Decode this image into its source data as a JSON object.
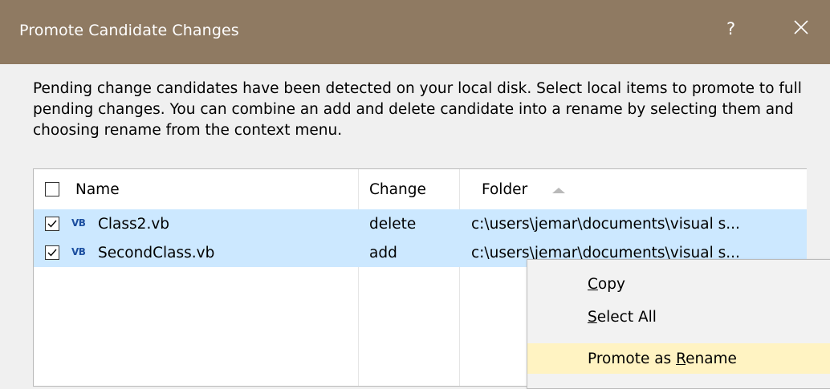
{
  "dialog": {
    "title": "Promote Candidate Changes",
    "help_label": "?",
    "description": "Pending change candidates have been detected on your local disk. Select local items to promote to full pending changes. You can combine an add and delete candidate into a rename by selecting them and choosing rename from the context menu.",
    "titlebar_color": "#8f7a62"
  },
  "list": {
    "columns": {
      "name": "Name",
      "change": "Change",
      "folder": "Folder"
    },
    "sort": {
      "column": "Folder",
      "direction": "ascending"
    },
    "select_all_checked": false,
    "rows": [
      {
        "checked": true,
        "icon": "VB",
        "name": "Class2.vb",
        "change": "delete",
        "folder": "c:\\users\\jemar\\documents\\visual s..."
      },
      {
        "checked": true,
        "icon": "VB",
        "name": "SecondClass.vb",
        "change": "add",
        "folder": "c:\\users\\jemar\\documents\\visual s..."
      }
    ],
    "selection_color": "#cce8ff"
  },
  "context_menu": {
    "items": [
      {
        "label_pre": "",
        "mnemonic": "C",
        "label_post": "opy"
      },
      {
        "label_pre": "",
        "mnemonic": "S",
        "label_post": "elect All"
      },
      {
        "label_pre": "Promote as ",
        "mnemonic": "R",
        "label_post": "ename",
        "highlighted": true
      }
    ],
    "highlight_color": "#fff3c2"
  }
}
